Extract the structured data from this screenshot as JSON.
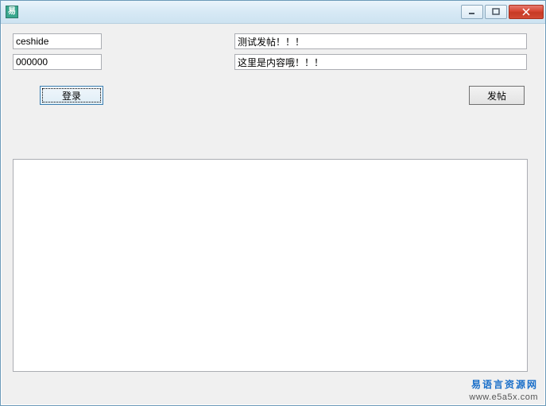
{
  "window": {
    "title": ""
  },
  "login": {
    "username": "ceshide",
    "password": "000000",
    "button_label": "登录"
  },
  "post": {
    "title": "测试发帖！！！",
    "content": "这里是内容哦！！！",
    "button_label": "发帖"
  },
  "output": {
    "text": ""
  },
  "footer": {
    "brand": "易语言资源网",
    "url": "www.e5a5x.com"
  }
}
